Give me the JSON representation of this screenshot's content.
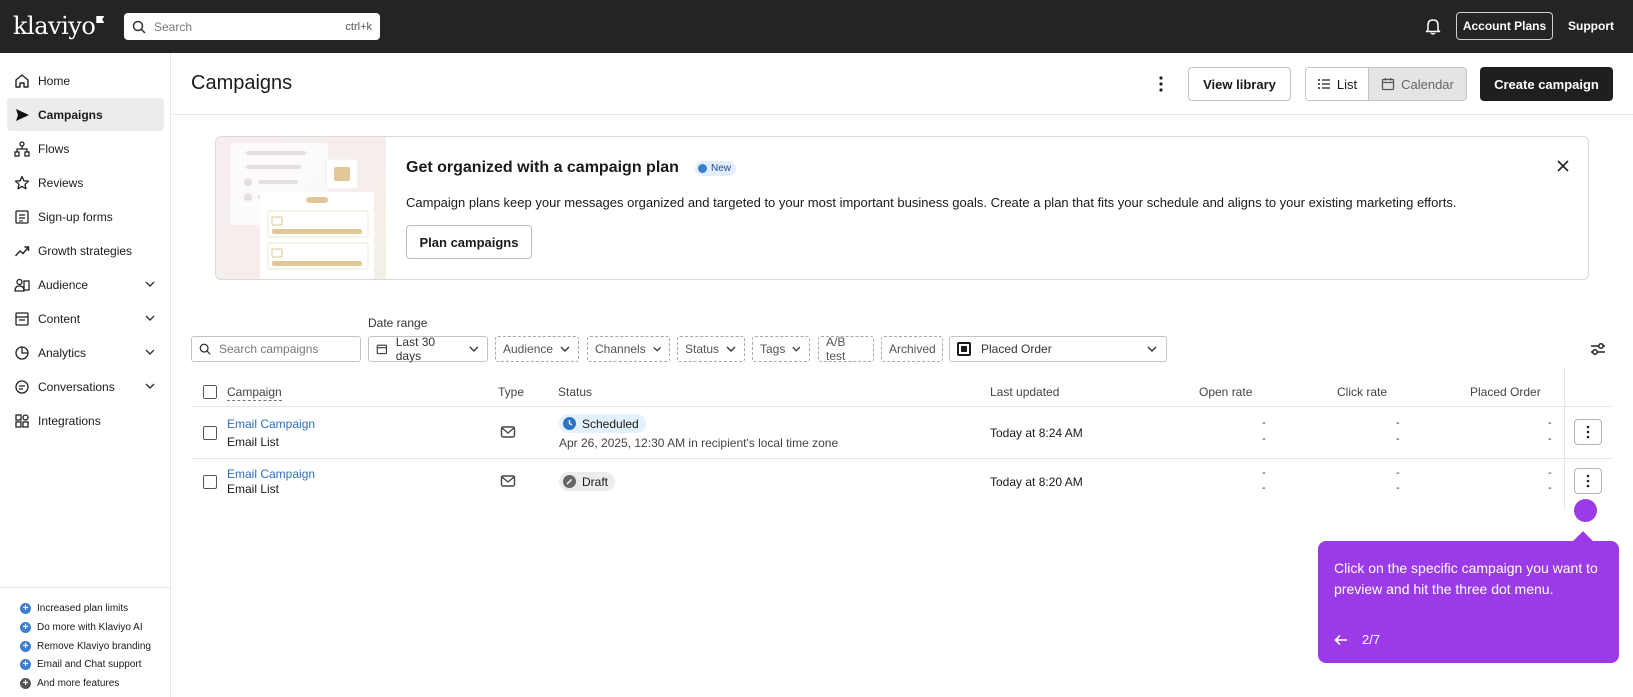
{
  "topbar": {
    "logo": "klaviyo",
    "search_placeholder": "Search",
    "search_shortcut": "ctrl+k",
    "account_plans": "Account Plans",
    "support": "Support"
  },
  "sidebar": {
    "items": [
      {
        "label": "Home",
        "icon": "home-icon"
      },
      {
        "label": "Campaigns",
        "icon": "send-icon",
        "active": true
      },
      {
        "label": "Flows",
        "icon": "flow-icon"
      },
      {
        "label": "Reviews",
        "icon": "star-icon"
      },
      {
        "label": "Sign-up forms",
        "icon": "form-icon"
      },
      {
        "label": "Growth strategies",
        "icon": "trend-icon"
      },
      {
        "label": "Audience",
        "icon": "audience-icon",
        "expandable": true
      },
      {
        "label": "Content",
        "icon": "content-icon",
        "expandable": true
      },
      {
        "label": "Analytics",
        "icon": "analytics-icon",
        "expandable": true
      },
      {
        "label": "Conversations",
        "icon": "chat-icon",
        "expandable": true
      },
      {
        "label": "Integrations",
        "icon": "integrations-icon"
      }
    ],
    "perks": [
      "Increased plan limits",
      "Do more with Klaviyo AI",
      "Remove Klaviyo branding",
      "Email and Chat support",
      "And more features"
    ]
  },
  "header": {
    "title": "Campaigns",
    "view_library": "View library",
    "list": "List",
    "calendar": "Calendar",
    "create_campaign": "Create campaign"
  },
  "banner": {
    "title": "Get organized with a campaign plan",
    "badge": "New",
    "description": "Campaign plans keep your messages organized and targeted to your most important business goals. Create a plan that fits your schedule and aligns to your existing marketing efforts.",
    "button": "Plan campaigns"
  },
  "filters": {
    "search_placeholder": "Search campaigns",
    "date_range_label": "Date range",
    "date_range_value": "Last 30 days",
    "audience": "Audience",
    "channels": "Channels",
    "status": "Status",
    "tags": "Tags",
    "ab_test": "A/B test",
    "archived": "Archived",
    "metric": "Placed Order"
  },
  "table": {
    "columns": [
      "Campaign",
      "Type",
      "Status",
      "Last updated",
      "Open rate",
      "Click rate",
      "Placed Order"
    ],
    "rows": [
      {
        "name": "Email Campaign",
        "list": "Email List",
        "type": "email",
        "status": "Scheduled",
        "status_detail": "Apr 26, 2025, 12:30 AM in recipient's local time zone",
        "updated": "Today at 8:24 AM",
        "open_rate": [
          "-",
          "-"
        ],
        "click_rate": [
          "-",
          "-"
        ],
        "placed_order": [
          "-",
          "-"
        ]
      },
      {
        "name": "Email Campaign",
        "list": "Email List",
        "type": "email",
        "status": "Draft",
        "status_detail": "",
        "updated": "Today at 8:20 AM",
        "open_rate": [
          "-",
          "-"
        ],
        "click_rate": [
          "-",
          "-"
        ],
        "placed_order": [
          "-",
          "-"
        ]
      }
    ]
  },
  "tour": {
    "message": "Click on the specific campaign you want to preview and hit the three dot menu.",
    "step": "2/7"
  },
  "colors": {
    "topbar": "#242424",
    "link": "#2d6fc2",
    "tour": "#9b3be8",
    "primary_button": "#1f1f1f"
  }
}
